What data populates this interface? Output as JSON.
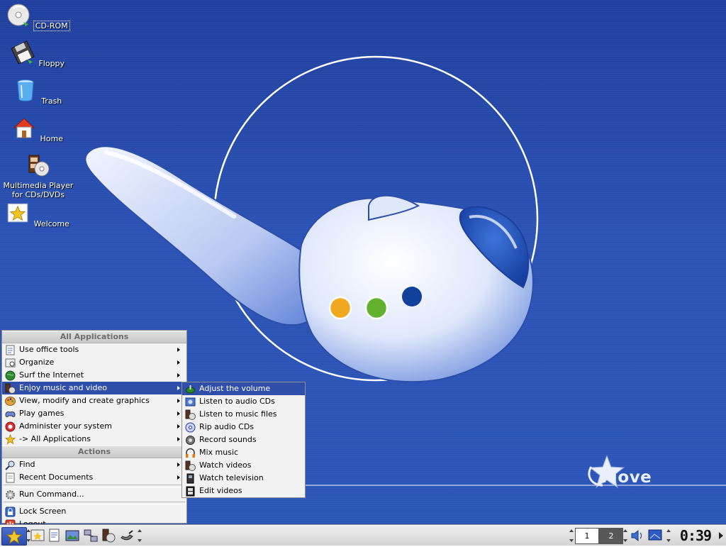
{
  "desktop": {
    "brand": "Move",
    "icons": [
      {
        "label": "CD-ROM",
        "icon": "cdrom-icon"
      },
      {
        "label": "Floppy",
        "icon": "floppy-icon"
      },
      {
        "label": "Trash",
        "icon": "trash-icon"
      },
      {
        "label": "Home",
        "icon": "home-icon"
      },
      {
        "label": "Multimedia Player\nfor CDs/DVDs",
        "icon": "multimedia-player-icon"
      },
      {
        "label": "Welcome",
        "icon": "welcome-star-icon"
      }
    ]
  },
  "start_menu": {
    "header_all": "All Applications",
    "header_actions": "Actions",
    "apps": [
      {
        "label": "Use office tools",
        "icon": "office-icon"
      },
      {
        "label": "Organize",
        "icon": "organize-icon"
      },
      {
        "label": "Surf the Internet",
        "icon": "globe-icon"
      },
      {
        "label": "Enjoy music and video",
        "icon": "multimedia-icon"
      },
      {
        "label": "View, modify and create graphics",
        "icon": "palette-icon"
      },
      {
        "label": "Play games",
        "icon": "gamepad-icon"
      },
      {
        "label": "Administer your system",
        "icon": "admin-icon"
      },
      {
        "label": "-> All Applications",
        "icon": "star-icon"
      }
    ],
    "actions": [
      {
        "label": "Find",
        "icon": "find-icon"
      },
      {
        "label": "Recent Documents",
        "icon": "documents-icon"
      },
      {
        "label": "Run Command...",
        "icon": "gear-icon"
      },
      {
        "label": "Lock Screen",
        "icon": "lock-icon"
      },
      {
        "label": "Logout...",
        "icon": "logout-icon"
      }
    ]
  },
  "submenu": {
    "items": [
      {
        "label": "Adjust the volume",
        "icon": "volume-icon"
      },
      {
        "label": "Listen to audio CDs",
        "icon": "cd-player-icon"
      },
      {
        "label": "Listen to music files",
        "icon": "music-files-icon"
      },
      {
        "label": "Rip audio CDs",
        "icon": "rip-cd-icon"
      },
      {
        "label": "Record sounds",
        "icon": "record-icon"
      },
      {
        "label": "Mix music",
        "icon": "headphones-icon"
      },
      {
        "label": "Watch videos",
        "icon": "video-icon"
      },
      {
        "label": "Watch television",
        "icon": "tv-icon"
      },
      {
        "label": "Edit videos",
        "icon": "film-edit-icon"
      }
    ]
  },
  "taskbar": {
    "pager": [
      "1",
      "2"
    ],
    "active_desktop": "2",
    "clock": "0:39",
    "colors": {
      "highlight": "#2f4faa",
      "wallpaper": "#2a52b4"
    }
  }
}
